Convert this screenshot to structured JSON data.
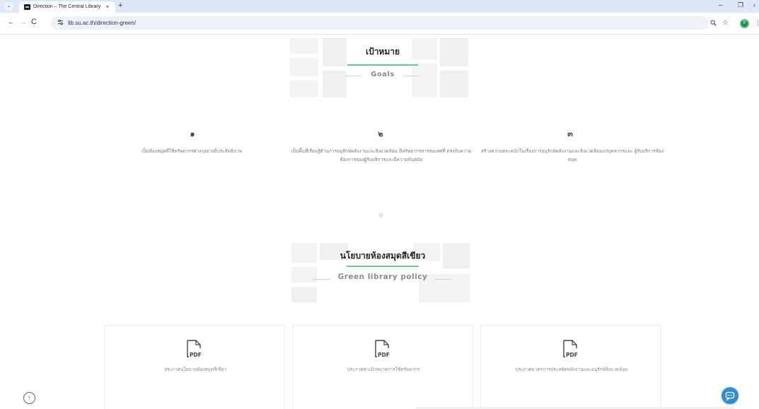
{
  "browser": {
    "tab_title": "Direction – The Central Library",
    "tab_close": "×",
    "new_tab": "+",
    "tab_dropdown": "⌄",
    "url": "lib.su.ac.th/direction-green/",
    "site_info_icon": "tune-icon",
    "back": "←",
    "forward": "→",
    "reload": "C",
    "zoom_icon": "🔍",
    "star": "☆",
    "profile_initial": "P",
    "menu": "⋮",
    "minimize": "–",
    "restore": "❐",
    "more": "›"
  },
  "goals": {
    "title_th": "เป้าหมาย",
    "title_en": "Goals",
    "items": [
      {
        "number": "๑",
        "text": "เป็นห้องสมุดที่ใช้ทรัพยากรต่างๆอย่างมีประสิทธิภาพ"
      },
      {
        "number": "๒",
        "text": "เป็นพื้นที่เรียนรู้ด้านการอนุรักษ์พลังงานและสิ่งแวดล้อม มีทรัพยากรสารสนเทศที่ ตรงกับความต้องการของผู้รับบริการและมีความทันสมัย"
      },
      {
        "number": "๓",
        "text": "สร้างความตระหนักในเรื่องการอนุรักษ์พลังงานและสิ่งแวดล้อมแก่บุคลากรและ ผู้รับบริการห้องสมุด"
      }
    ]
  },
  "policy": {
    "title_th": "นโยบายห้องสมุดสีเขียว",
    "title_en": "Green library policy",
    "documents": [
      {
        "label": "ประกาศนโยบายห้องสมุดสีเขียว",
        "icon_text": "PDF"
      },
      {
        "label": "ประกาศค่าเป้าหมายการใช้ทรัพยากร",
        "icon_text": "PDF"
      },
      {
        "label": "ประกาศมาตรการประหยัดพลังงานและอนุรักษ์สิ่งแวดล้อม",
        "icon_text": "PDF"
      }
    ]
  },
  "scroll_top_icon": "↑",
  "colors": {
    "accent": "#6cc49a",
    "chat": "#2f8fcf",
    "tabbar": "#dfe7f6"
  }
}
